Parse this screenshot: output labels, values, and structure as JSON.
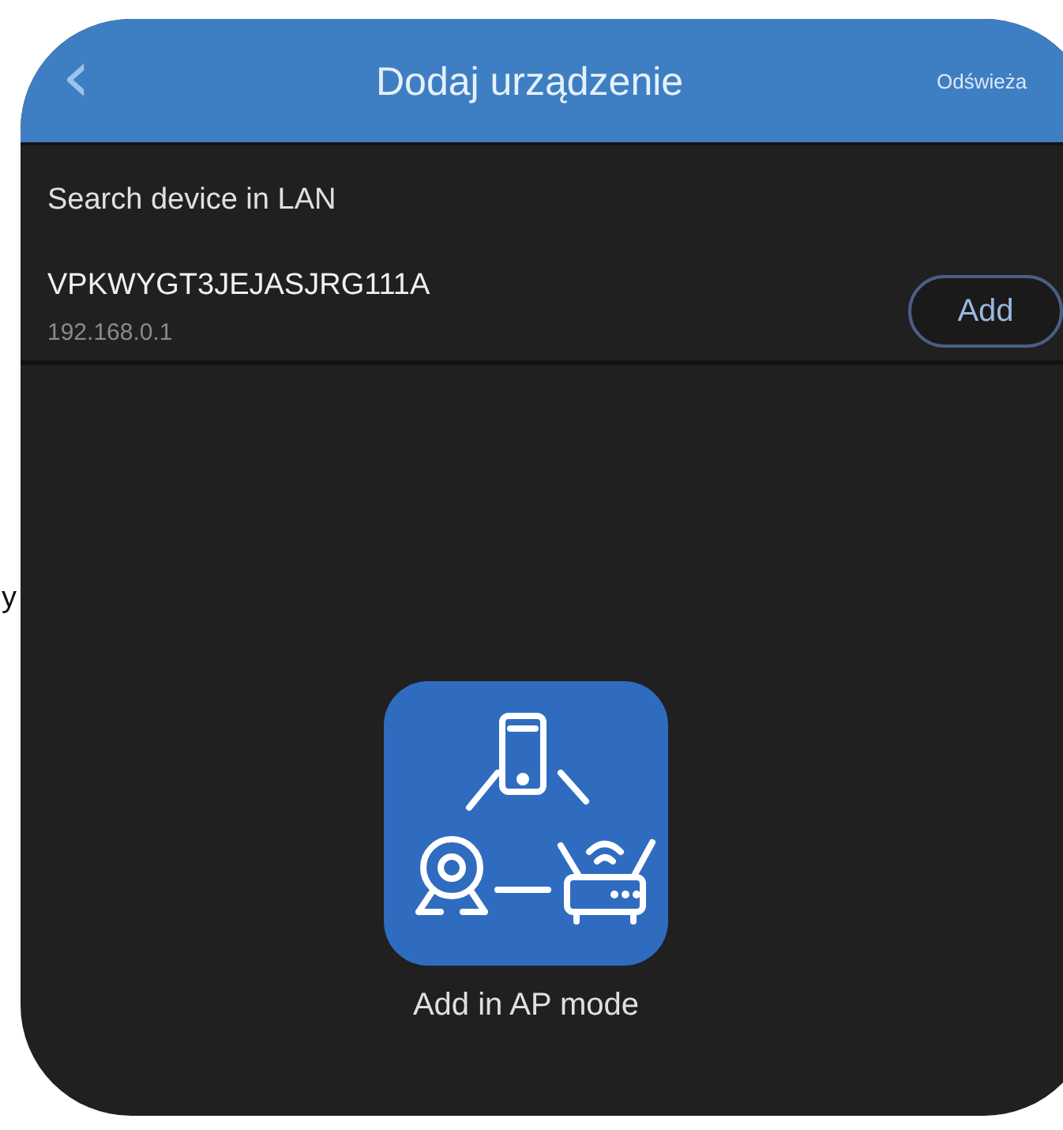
{
  "margin_text": "y",
  "header": {
    "back_icon": "‹",
    "title": "Dodaj urządzenie",
    "action": "Odświeża"
  },
  "section_title": "Search device in LAN",
  "devices": [
    {
      "name": "VPKWYGT3JEJASJRG111A",
      "ip": "192.168.0.1",
      "button": "Add"
    }
  ],
  "ap_mode": {
    "label": "Add in AP mode"
  }
}
